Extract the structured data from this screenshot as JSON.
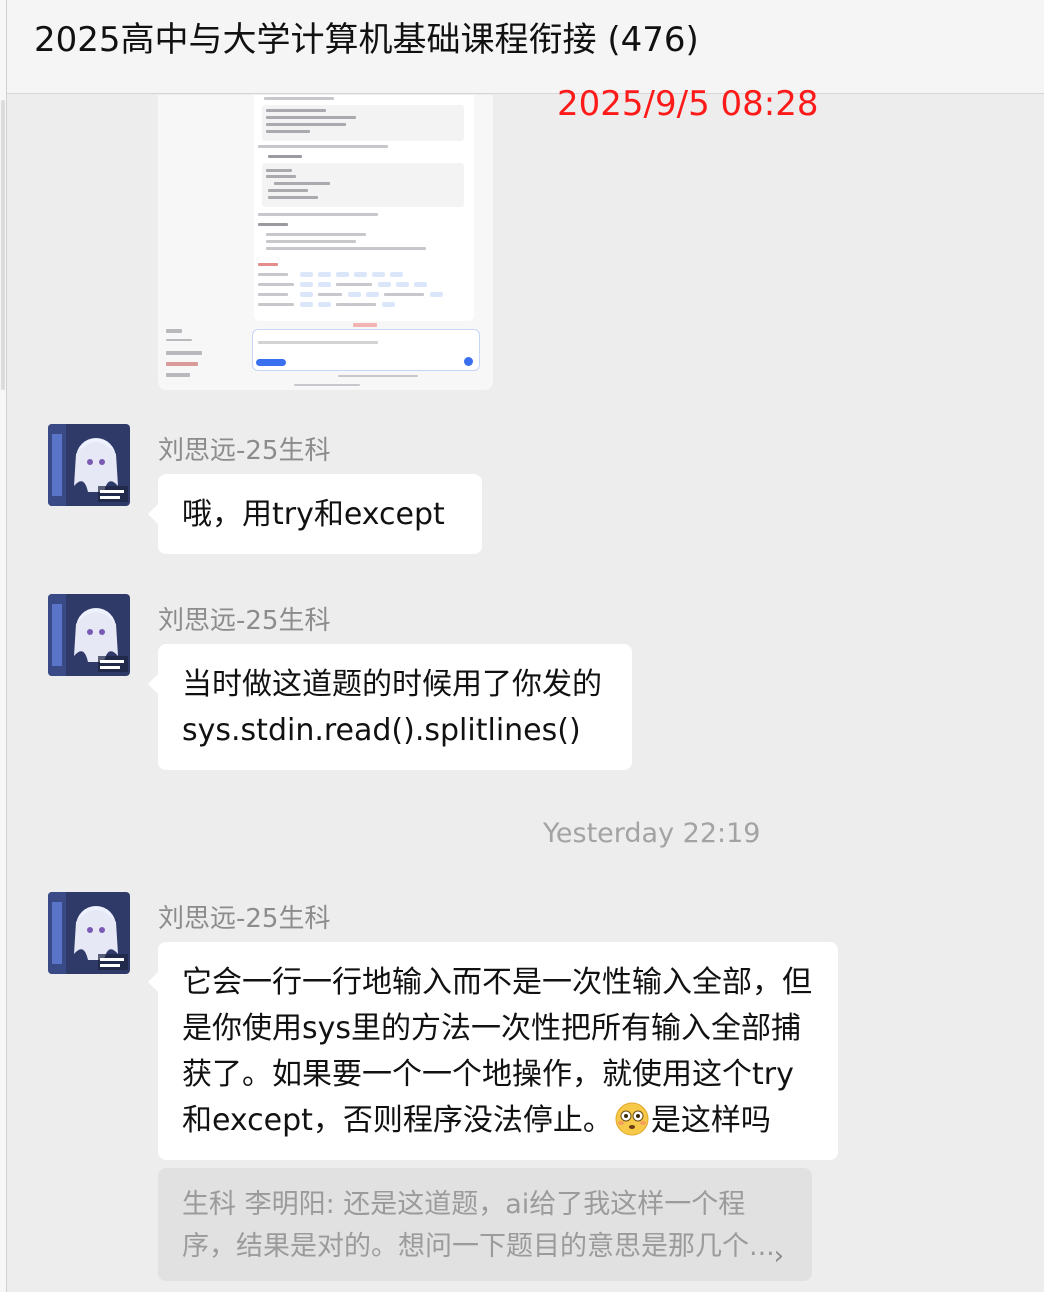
{
  "chat": {
    "title": "2025高中与大学计算机基础课程衔接 (476)",
    "date_stamp": "2025/9/5 08:28"
  },
  "messages": [
    {
      "sender": "刘思远-25生科",
      "lines": [
        "哦，用try和except"
      ]
    },
    {
      "sender": "刘思远-25生科",
      "lines": [
        "当时做这道题的时候用了你发的",
        "sys.stdin.read().splitlines()"
      ]
    },
    {
      "sender": "刘思远-25生科",
      "lines": [
        "它会一行一行地输入而不是一次性输入全部，但",
        "是你使用sys里的方法一次性把所有输入全部捕",
        "获了。如果要一个一个地操作，就使用这个try"
      ],
      "last_line_before_emoji": "和except，否则程序没法停止。",
      "last_line_after_emoji": "是这样吗",
      "emoji": "flushed-face-icon"
    }
  ],
  "time_separator": "Yesterday 22:19",
  "quote": {
    "lines": [
      "生科 李明阳: 还是这道题，ai给了我这样一个程",
      "序，结果是对的。想问一下题目的意思是那几个..."
    ],
    "chevron": "›"
  },
  "colors": {
    "date_stamp": "#ff1a1a",
    "background": "#ededed",
    "bubble": "#ffffff"
  }
}
